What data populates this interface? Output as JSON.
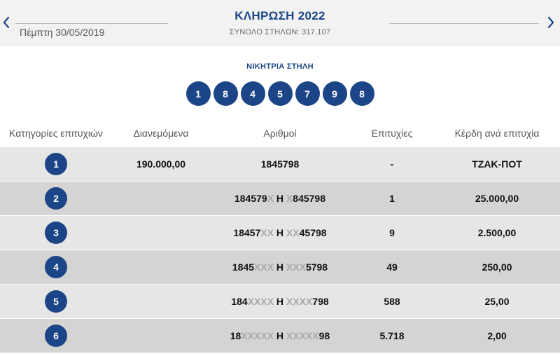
{
  "header": {
    "title": "ΚΛΗΡΩΣΗ 2022",
    "total_columns": "ΣΥΝΟΛΟ ΣΤΗΛΩΝ: 317.107",
    "draw_date": "Πέμπτη 30/05/2019",
    "prev_icon": "chevron-left-icon",
    "next_icon": "chevron-right-icon"
  },
  "winning": {
    "label": "ΝΙΚΗΤΡΙΑ ΣΤΗΛΗ",
    "numbers": [
      "1",
      "8",
      "4",
      "5",
      "7",
      "9",
      "8"
    ]
  },
  "table": {
    "headers": {
      "category": "Κατηγορίες επιτυχιών",
      "distributed": "Διανεμόμενα",
      "numbers": "Αριθμοί",
      "wins": "Επιτυχίες",
      "prize": "Κέρδη ανά επιτυχία"
    },
    "rows": [
      {
        "category": "1",
        "distributed": "190.000,00",
        "num_a": "1845798",
        "num_a_mask": "",
        "sep": "",
        "num_b_mask": "",
        "num_b": "",
        "wins": "-",
        "prize": "ΤΖΑΚ-ΠΟΤ"
      },
      {
        "category": "2",
        "distributed": "",
        "num_a": "184579",
        "num_a_mask": "X",
        "sep": " Η ",
        "num_b_mask": "X",
        "num_b": "845798",
        "wins": "1",
        "prize": "25.000,00"
      },
      {
        "category": "3",
        "distributed": "",
        "num_a": "18457",
        "num_a_mask": "XX",
        "sep": " Η ",
        "num_b_mask": "XX",
        "num_b": "45798",
        "wins": "9",
        "prize": "2.500,00"
      },
      {
        "category": "4",
        "distributed": "",
        "num_a": "1845",
        "num_a_mask": "XXX",
        "sep": " Η ",
        "num_b_mask": "XXX",
        "num_b": "5798",
        "wins": "49",
        "prize": "250,00"
      },
      {
        "category": "5",
        "distributed": "",
        "num_a": "184",
        "num_a_mask": "XXXX",
        "sep": " Η ",
        "num_b_mask": "XXXX",
        "num_b": "798",
        "wins": "588",
        "prize": "25,00"
      },
      {
        "category": "6",
        "distributed": "",
        "num_a": "18",
        "num_a_mask": "XXXXX",
        "sep": " Η ",
        "num_b_mask": "XXXXX",
        "num_b": "98",
        "wins": "5.718",
        "prize": "2,00"
      }
    ]
  },
  "colors": {
    "brand_blue": "#1b4586",
    "header_bg": "#f2f2f2",
    "row_light": "#e6e6e6",
    "row_dark": "#d4d4d4",
    "mask_gray": "#a8a8a8"
  }
}
